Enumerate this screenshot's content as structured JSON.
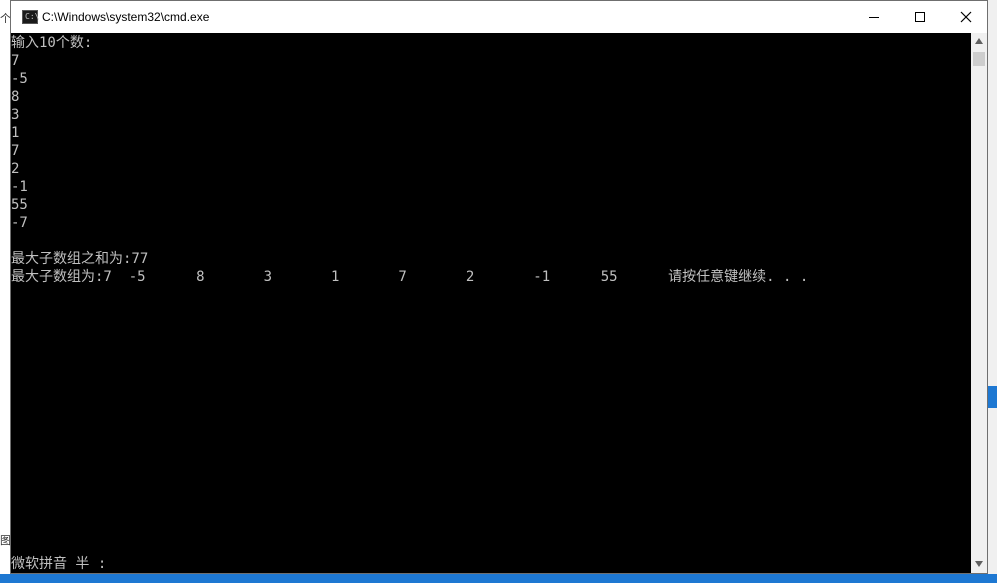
{
  "background": {
    "left_text_top": "个",
    "left_text_bottom": "图"
  },
  "window": {
    "title": "C:\\Windows\\system32\\cmd.exe",
    "icon": "cmd-icon",
    "icon_prompt": "C:\\",
    "controls": {
      "minimize_icon": "minimize-icon",
      "maximize_icon": "maximize-icon",
      "close_icon": "close-icon"
    }
  },
  "console": {
    "lines": [
      "输入10个数:",
      "7",
      "-5",
      "8",
      "3",
      "1",
      "7",
      "2",
      "-1",
      "55",
      "-7",
      "",
      "最大子数组之和为:77",
      "最大子数组为:7  -5      8       3       1       7       2       -1      55      请按任意键继续. . ."
    ],
    "ime_status": "微软拼音 半 :"
  },
  "colors": {
    "console_bg": "#000000",
    "console_text": "#c0c0c0",
    "titlebar_bg": "#ffffff",
    "accent": "#1e78d2"
  }
}
